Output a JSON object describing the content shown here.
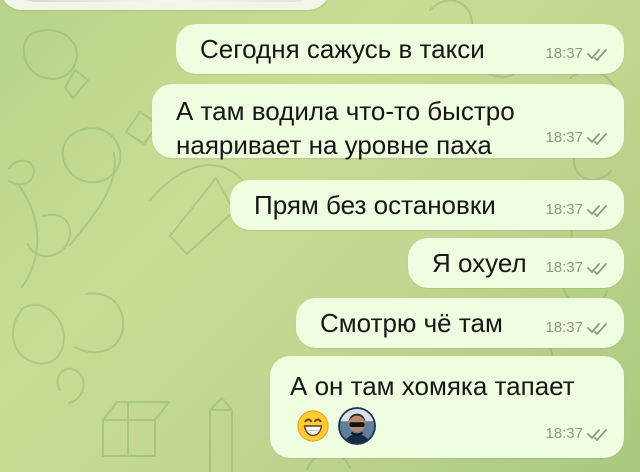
{
  "theme": {
    "accent": "#4fa66b",
    "outgoing_bubble": "#effde0",
    "background": "#c2d98e",
    "meta_text": "#8c9b7c"
  },
  "messages": [
    {
      "text": "Сегодня сажусь в такси",
      "time": "18:37",
      "status_icon": "double-check-icon"
    },
    {
      "lines": [
        "А там водила что-то быстро",
        "наяривает на уровне паха"
      ],
      "time": "18:37",
      "status_icon": "double-check-icon"
    },
    {
      "text": "Прям без остановки",
      "time": "18:37",
      "status_icon": "double-check-icon"
    },
    {
      "text": "Я охуел",
      "time": "18:37",
      "status_icon": "double-check-icon"
    },
    {
      "text": "Смотрю чё там",
      "time": "18:37",
      "status_icon": "double-check-icon"
    },
    {
      "text": "А он там хомяка тапает",
      "time": "18:37",
      "status_icon": "double-check-icon",
      "emoji": [
        "grinning-face-emoji",
        "avatar-emoji"
      ]
    }
  ]
}
